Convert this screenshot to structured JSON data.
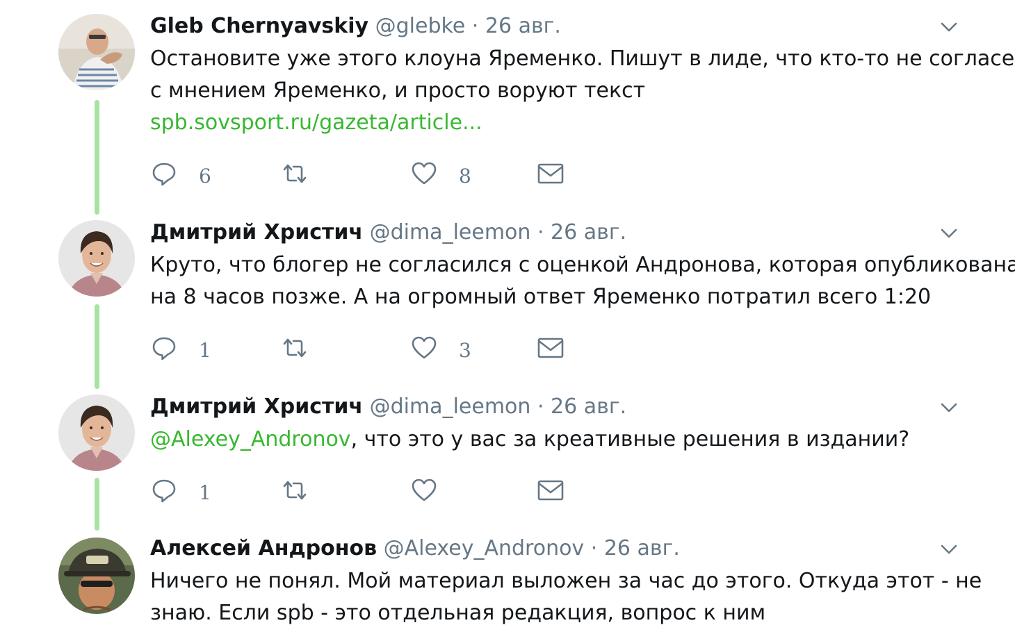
{
  "tweets": [
    {
      "name": "Gleb Chernyavskiy",
      "handle": "@glebke",
      "sep": "·",
      "date": "26 авг.",
      "lines": [
        "Остановите уже этого клоуна Яременко. Пишут в лиде, что кто-то не согласен",
        "с мнением Яременко, и просто воруют текст"
      ],
      "link": "spb.sovsport.ru/gazeta/article...",
      "replies": "6",
      "retweets": "",
      "likes": "8"
    },
    {
      "name": "Дмитрий Христич",
      "handle": "@dima_leemon",
      "sep": "·",
      "date": "26 авг.",
      "lines": [
        "Круто, что блогер не согласился с оценкой Андронова, которая опубликована",
        "на 8 часов позже. А на огромный ответ Яременко потратил всего 1:20"
      ],
      "replies": "1",
      "retweets": "",
      "likes": "3"
    },
    {
      "name": "Дмитрий Христич",
      "handle": "@dima_leemon",
      "sep": "·",
      "date": "26 авг.",
      "mention": "@Alexey_Andronov",
      "text_rest": ", что это у вас за креативные решения в издании?",
      "replies": "1",
      "retweets": "",
      "likes": ""
    },
    {
      "name": "Алексей Андронов",
      "handle": "@Alexey_Andronov",
      "sep": "·",
      "date": "26 авг.",
      "lines": [
        "Ничего не понял. Мой материал выложен за час до этого. Откуда этот - не",
        "знаю. Если spb - это отдельная редакция, вопрос к ним"
      ]
    }
  ],
  "icons": {
    "reply": "reply-icon",
    "retweet": "retweet-icon",
    "like": "heart-icon",
    "dm": "envelope-icon",
    "caret": "chevron-down-icon"
  },
  "colors": {
    "link": "#37b830",
    "thread_line": "#a7e3a1",
    "muted": "#657786",
    "text": "#14171a"
  }
}
